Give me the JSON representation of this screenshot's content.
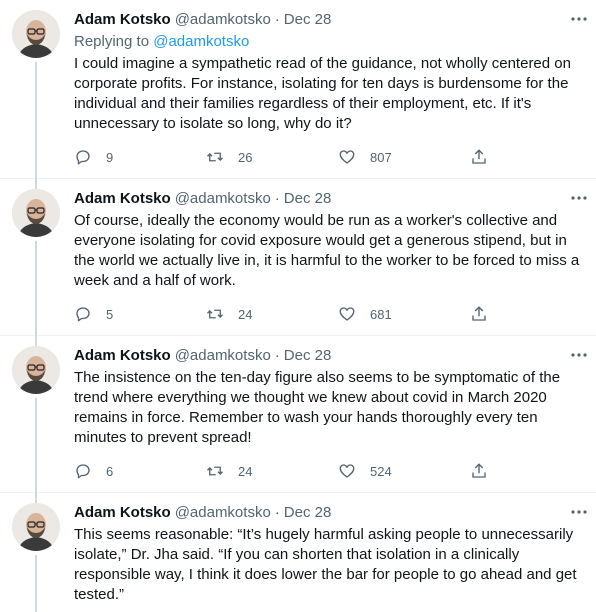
{
  "tweets": [
    {
      "name": "Adam Kotsko",
      "handle": "@adamkotsko",
      "separator": "·",
      "date": "Dec 28",
      "replying_prefix": "Replying to ",
      "replying_to": "@adamkotsko",
      "text": "I could imagine a sympathetic read of the guidance, not wholly centered on corporate profits. For instance, isolating for ten days is burdensome for the individual and their families regardless of their employment, etc. If it's unnecessary to isolate so long, why do it?",
      "replies": "9",
      "retweets": "26",
      "likes": "807"
    },
    {
      "name": "Adam Kotsko",
      "handle": "@adamkotsko",
      "separator": "·",
      "date": "Dec 28",
      "text": "Of course, ideally the economy would be run as a worker's collective and everyone isolating for covid exposure would get a generous stipend, but in the world we actually live in, it is harmful to the worker to be forced to miss a week and a half of work.",
      "replies": "5",
      "retweets": "24",
      "likes": "681"
    },
    {
      "name": "Adam Kotsko",
      "handle": "@adamkotsko",
      "separator": "·",
      "date": "Dec 28",
      "text": "The insistence on the ten-day figure also seems to be symptomatic of the trend where everything we thought we knew about covid in March 2020 remains in force. Remember to wash your hands thoroughly every ten minutes to prevent spread!",
      "replies": "6",
      "retweets": "24",
      "likes": "524"
    },
    {
      "name": "Adam Kotsko",
      "handle": "@adamkotsko",
      "separator": "·",
      "date": "Dec 28",
      "text": "This seems reasonable: “It’s hugely harmful asking people to unnecessarily isolate,” Dr. Jha said. “If you can shorten that isolation in a clinically responsible way, I think it does lower the bar for people to go ahead and get tested.”"
    }
  ],
  "icons": {
    "more": "more-horizontal-icon",
    "reply": "reply-bubble-icon",
    "retweet": "retweet-arrows-icon",
    "like": "heart-icon",
    "share": "share-upload-icon"
  },
  "colors": {
    "text": "#0f1419",
    "secondary": "#536471",
    "link": "#1d9bf0",
    "thread_line": "#cfd9de",
    "divider": "#eff3f4"
  }
}
